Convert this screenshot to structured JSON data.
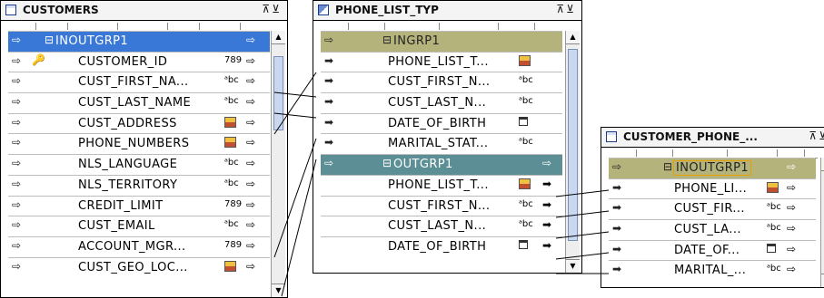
{
  "customers": {
    "title": "CUSTOMERS",
    "controls": "⊼⊻",
    "group": "INOUTGRP1",
    "rows": [
      {
        "label": "CUSTOMER_ID",
        "type": "789",
        "key": true
      },
      {
        "label": "CUST_FIRST_NA...",
        "type": "abc"
      },
      {
        "label": "CUST_LAST_NAME",
        "type": "abc"
      },
      {
        "label": "CUST_ADDRESS",
        "type": "img"
      },
      {
        "label": "PHONE_NUMBERS",
        "type": "img"
      },
      {
        "label": "NLS_LANGUAGE",
        "type": "abc"
      },
      {
        "label": "NLS_TERRITORY",
        "type": "abc"
      },
      {
        "label": "CREDIT_LIMIT",
        "type": "789"
      },
      {
        "label": "CUST_EMAIL",
        "type": "abc"
      },
      {
        "label": "ACCOUNT_MGR...",
        "type": "789"
      },
      {
        "label": "CUST_GEO_LOC...",
        "type": "img"
      }
    ]
  },
  "phone_list_typ": {
    "title": "PHONE_LIST_TYP",
    "controls": "⊼⊻",
    "in_group": "INGRP1",
    "in_rows": [
      {
        "label": "PHONE_LIST_T...",
        "type": "img"
      },
      {
        "label": "CUST_FIRST_N...",
        "type": "abc"
      },
      {
        "label": "CUST_LAST_N...",
        "type": "abc"
      },
      {
        "label": "DATE_OF_BIRTH",
        "type": "cal"
      },
      {
        "label": "MARITAL_STAT...",
        "type": "abc"
      }
    ],
    "out_group": "OUTGRP1",
    "out_rows": [
      {
        "label": "PHONE_LIST_T...",
        "type": "img"
      },
      {
        "label": "CUST_FIRST_N...",
        "type": "abc"
      },
      {
        "label": "CUST_LAST_N...",
        "type": "abc"
      },
      {
        "label": "DATE_OF_BIRTH",
        "type": "cal"
      }
    ]
  },
  "customer_phone": {
    "title": "CUSTOMER_PHONE_...",
    "controls": "⊼⊻",
    "group": "INOUTGRP1",
    "rows": [
      {
        "label": "PHONE_LI...",
        "type": "img"
      },
      {
        "label": "CUST_FIR...",
        "type": "abc"
      },
      {
        "label": "CUST_LA...",
        "type": "abc"
      },
      {
        "label": "DATE_OF...",
        "type": "cal"
      },
      {
        "label": "MARITAL_...",
        "type": "abc"
      }
    ]
  },
  "type_glyphs": {
    "abc": "ᵃbc",
    "789": "789"
  },
  "colors": {
    "inout_group": "#3a78d8",
    "in_group": "#b5b37c",
    "out_group": "#5b8f95",
    "group_border": "#e8a000"
  }
}
